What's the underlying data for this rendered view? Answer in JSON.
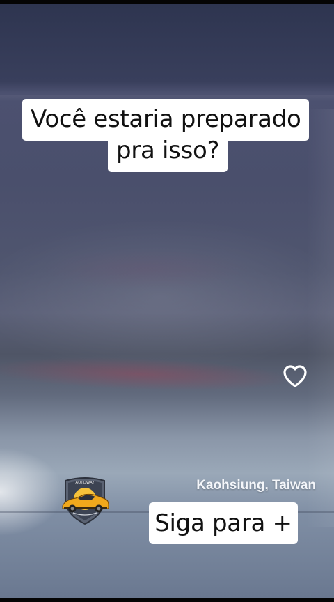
{
  "caption": {
    "line1": "Você estaria preparado",
    "line2": "pra isso?"
  },
  "overlay": {
    "like_icon": "heart-outline-icon",
    "location": "Kaohsiung, Taiwan",
    "follow_label": "Siga para +",
    "logo_icon": "car-badge-logo"
  },
  "colors": {
    "caption_bg": "#ffffff",
    "caption_text": "#111111",
    "car_body": "#f0a81c"
  }
}
